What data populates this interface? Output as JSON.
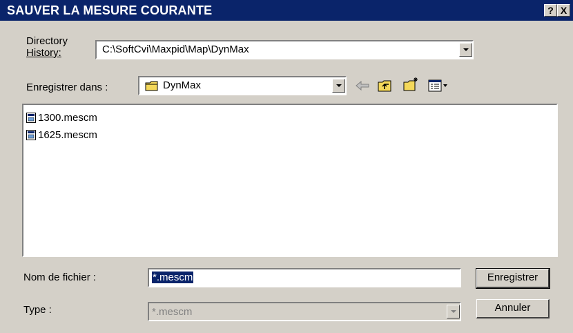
{
  "dialog": {
    "title": "SAUVER LA MESURE COURANTE",
    "help_label": "?",
    "close_label": "X"
  },
  "directory_history": {
    "label_line1": "Directory",
    "label_line2": "History:",
    "value": "C:\\SoftCvi\\Maxpid\\Map\\DynMax"
  },
  "save_in": {
    "label": "Enregistrer dans :",
    "value": "DynMax"
  },
  "toolbar": {
    "icons": [
      "back-arrow-icon",
      "up-folder-icon",
      "new-folder-icon",
      "view-menu-icon"
    ]
  },
  "files": [
    {
      "name": "1300.mescm"
    },
    {
      "name": "1625.mescm"
    }
  ],
  "filename": {
    "label": "Nom de fichier :",
    "value": "*.mescm"
  },
  "filetype": {
    "label": "Type :",
    "value": "*.mescm"
  },
  "buttons": {
    "save": "Enregistrer",
    "cancel": "Annuler"
  },
  "colors": {
    "titlebar": "#0a246a",
    "dialog_bg": "#d4d0c8",
    "folder": "#f4d85a"
  }
}
